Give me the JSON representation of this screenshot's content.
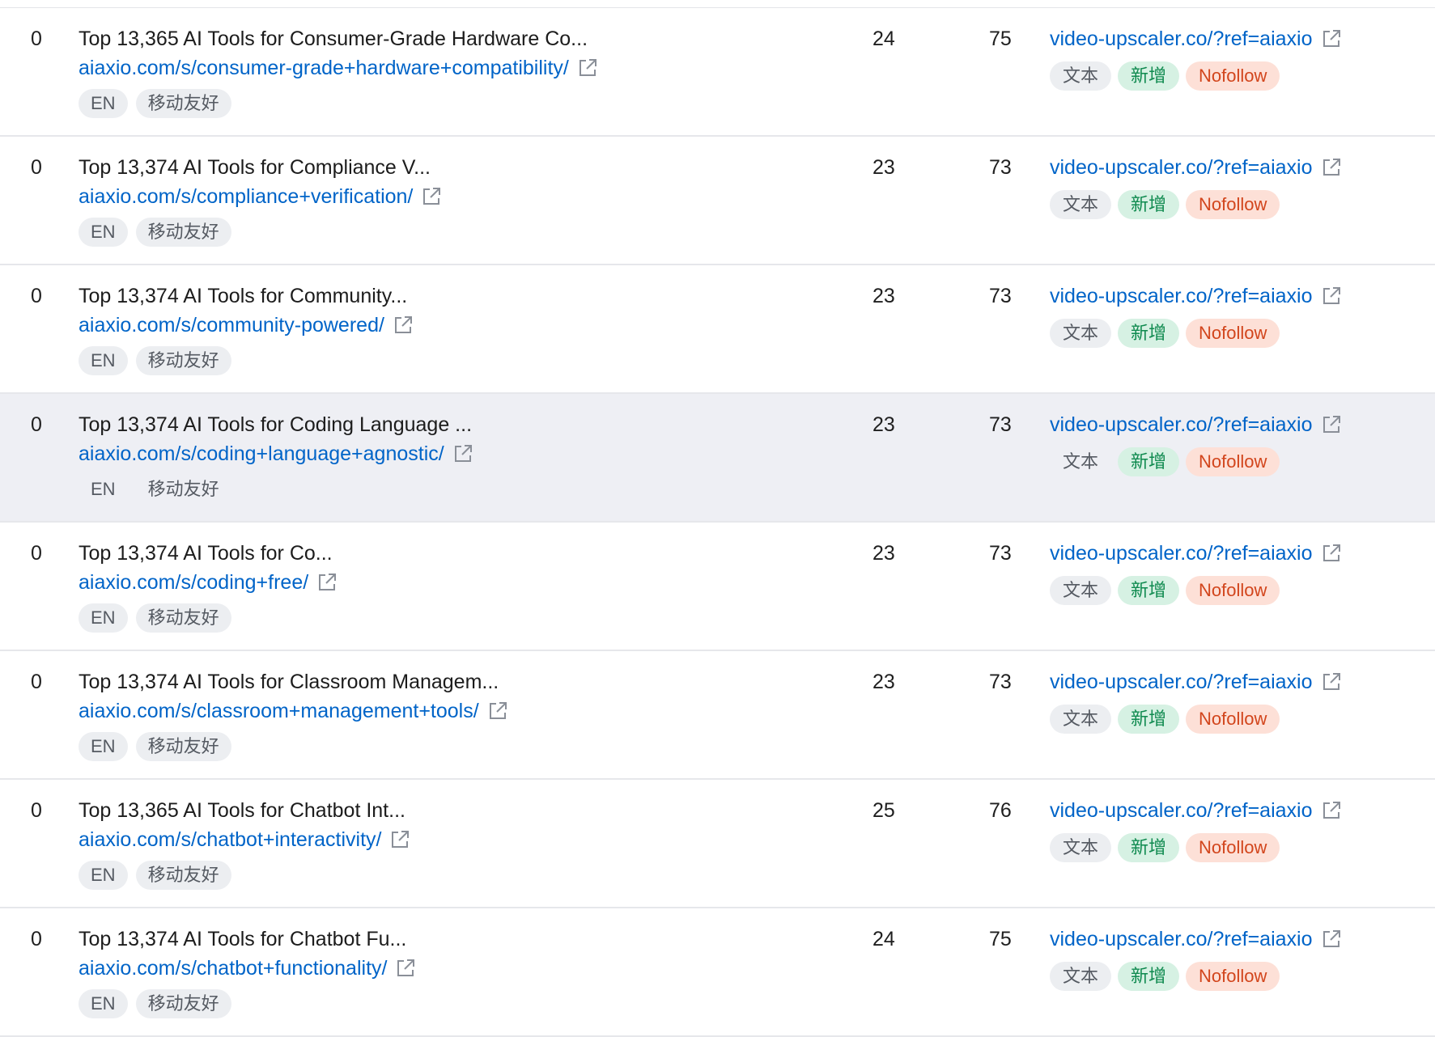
{
  "rows": [
    {
      "zero": "0",
      "title": "Top 13,365 AI Tools for Consumer-Grade Hardware Co...",
      "source_url": "aiaxio.com/s/consumer-grade+hardware+compatibility/",
      "lang": "EN",
      "mobile": "移动友好",
      "num1": "24",
      "num2": "75",
      "target_url": "video-upscaler.co/?ref=aiaxio",
      "badge_text": "文本",
      "badge_new": "新增",
      "badge_nofollow": "Nofollow"
    },
    {
      "zero": "0",
      "title": "Top 13,374 AI Tools for Compliance V...",
      "source_url": "aiaxio.com/s/compliance+verification/",
      "lang": "EN",
      "mobile": "移动友好",
      "num1": "23",
      "num2": "73",
      "target_url": "video-upscaler.co/?ref=aiaxio",
      "badge_text": "文本",
      "badge_new": "新增",
      "badge_nofollow": "Nofollow"
    },
    {
      "zero": "0",
      "title": "Top 13,374 AI Tools for Community...",
      "source_url": "aiaxio.com/s/community-powered/",
      "lang": "EN",
      "mobile": "移动友好",
      "num1": "23",
      "num2": "73",
      "target_url": "video-upscaler.co/?ref=aiaxio",
      "badge_text": "文本",
      "badge_new": "新增",
      "badge_nofollow": "Nofollow"
    },
    {
      "zero": "0",
      "title": "Top 13,374 AI Tools for Coding Language ...",
      "source_url": "aiaxio.com/s/coding+language+agnostic/",
      "lang": "EN",
      "mobile": "移动友好",
      "num1": "23",
      "num2": "73",
      "target_url": "video-upscaler.co/?ref=aiaxio",
      "badge_text": "文本",
      "badge_new": "新增",
      "badge_nofollow": "Nofollow"
    },
    {
      "zero": "0",
      "title": "Top 13,374 AI Tools for Co...",
      "source_url": "aiaxio.com/s/coding+free/",
      "lang": "EN",
      "mobile": "移动友好",
      "num1": "23",
      "num2": "73",
      "target_url": "video-upscaler.co/?ref=aiaxio",
      "badge_text": "文本",
      "badge_new": "新增",
      "badge_nofollow": "Nofollow"
    },
    {
      "zero": "0",
      "title": "Top 13,374 AI Tools for Classroom Managem...",
      "source_url": "aiaxio.com/s/classroom+management+tools/",
      "lang": "EN",
      "mobile": "移动友好",
      "num1": "23",
      "num2": "73",
      "target_url": "video-upscaler.co/?ref=aiaxio",
      "badge_text": "文本",
      "badge_new": "新增",
      "badge_nofollow": "Nofollow"
    },
    {
      "zero": "0",
      "title": "Top 13,365 AI Tools for Chatbot Int...",
      "source_url": "aiaxio.com/s/chatbot+interactivity/",
      "lang": "EN",
      "mobile": "移动友好",
      "num1": "25",
      "num2": "76",
      "target_url": "video-upscaler.co/?ref=aiaxio",
      "badge_text": "文本",
      "badge_new": "新增",
      "badge_nofollow": "Nofollow"
    },
    {
      "zero": "0",
      "title": "Top 13,374 AI Tools for Chatbot Fu...",
      "source_url": "aiaxio.com/s/chatbot+functionality/",
      "lang": "EN",
      "mobile": "移动友好",
      "num1": "24",
      "num2": "75",
      "target_url": "video-upscaler.co/?ref=aiaxio",
      "badge_text": "文本",
      "badge_new": "新增",
      "badge_nofollow": "Nofollow"
    }
  ],
  "hovered_row": 3,
  "icons": {
    "link": "external-link-icon"
  },
  "colors": {
    "link": "#0064c8",
    "badge_new_bg": "#d6f1e3",
    "badge_new_fg": "#0f8a4f",
    "badge_nofollow_bg": "#fde0d7",
    "badge_nofollow_fg": "#d2451c",
    "hover_row_bg": "#eeeff4"
  }
}
